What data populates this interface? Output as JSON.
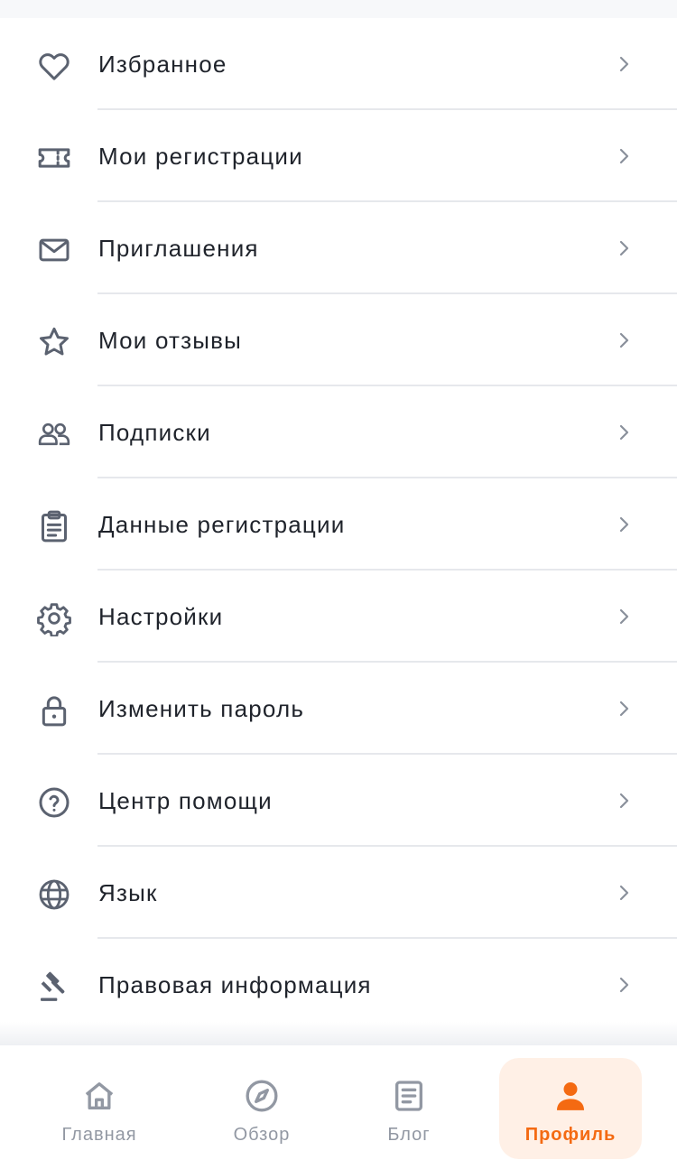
{
  "menu": {
    "items": [
      {
        "label": "Избранное",
        "icon": "heart-icon"
      },
      {
        "label": "Мои регистрации",
        "icon": "ticket-icon"
      },
      {
        "label": "Приглашения",
        "icon": "envelope-icon"
      },
      {
        "label": "Мои отзывы",
        "icon": "star-icon"
      },
      {
        "label": "Подписки",
        "icon": "users-icon"
      },
      {
        "label": "Данные регистрации",
        "icon": "clipboard-icon"
      },
      {
        "label": "Настройки",
        "icon": "gear-icon"
      },
      {
        "label": "Изменить пароль",
        "icon": "lock-icon"
      },
      {
        "label": "Центр помощи",
        "icon": "help-circle-icon"
      },
      {
        "label": "Язык",
        "icon": "globe-icon"
      },
      {
        "label": "Правовая информация",
        "icon": "gavel-icon"
      }
    ]
  },
  "tabbar": {
    "tabs": [
      {
        "label": "Главная",
        "icon": "home-icon",
        "active": false
      },
      {
        "label": "Обзор",
        "icon": "compass-icon",
        "active": false
      },
      {
        "label": "Блог",
        "icon": "document-icon",
        "active": false
      },
      {
        "label": "Профиль",
        "icon": "person-icon",
        "active": true
      }
    ]
  },
  "colors": {
    "accent": "#f46a12",
    "accent_bg": "#fff0e6",
    "text": "#1f232b",
    "icon": "#5b6270",
    "muted": "#9298a3",
    "separator": "#e6e8ec"
  }
}
